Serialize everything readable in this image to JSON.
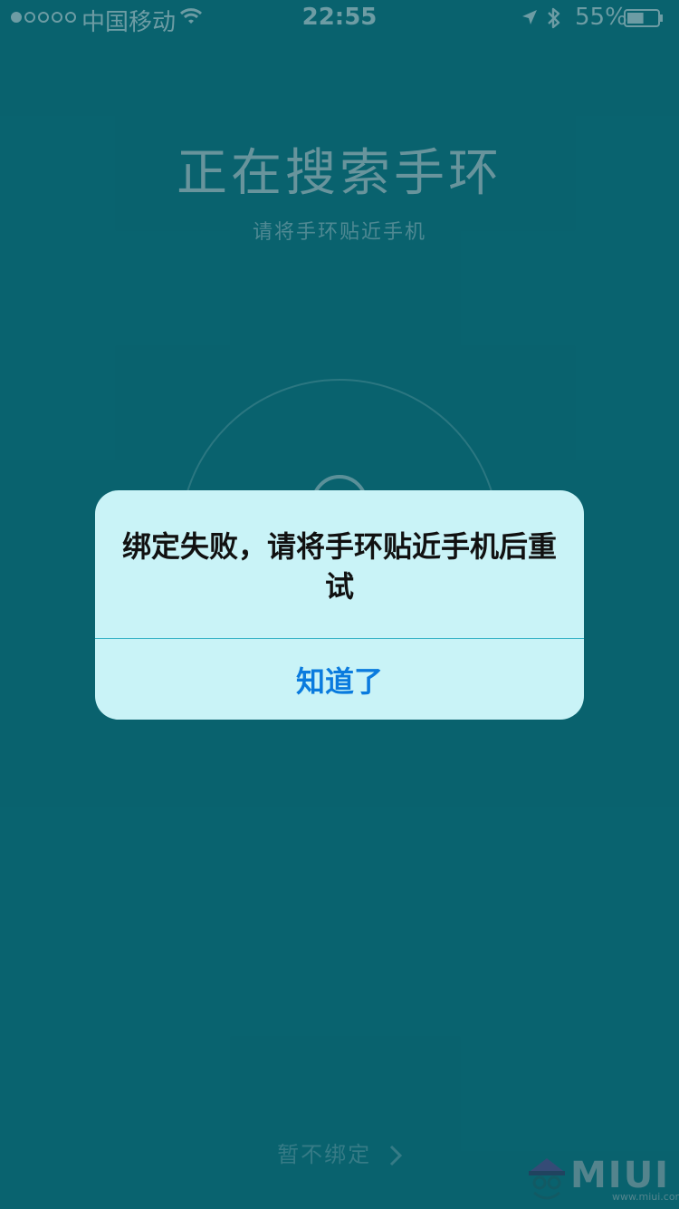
{
  "status_bar": {
    "carrier": "中国移动",
    "time": "22:55",
    "battery": "55%",
    "battery_level": 0.55,
    "signal_dots_filled": 1,
    "signal_dots_total": 5
  },
  "main": {
    "title": "正在搜索手环",
    "subtitle": "请将手环贴近手机"
  },
  "dialog": {
    "message": "绑定失败，请将手环贴近手机后重试",
    "button": "知道了"
  },
  "footer": {
    "skip": "暂不绑定"
  },
  "watermark": {
    "text": "MIUI",
    "url": "www.miui.com"
  },
  "colors": {
    "background": "#0a6d7a",
    "dialog_bg": "#c9f3f7",
    "accent": "#0a7bde"
  }
}
